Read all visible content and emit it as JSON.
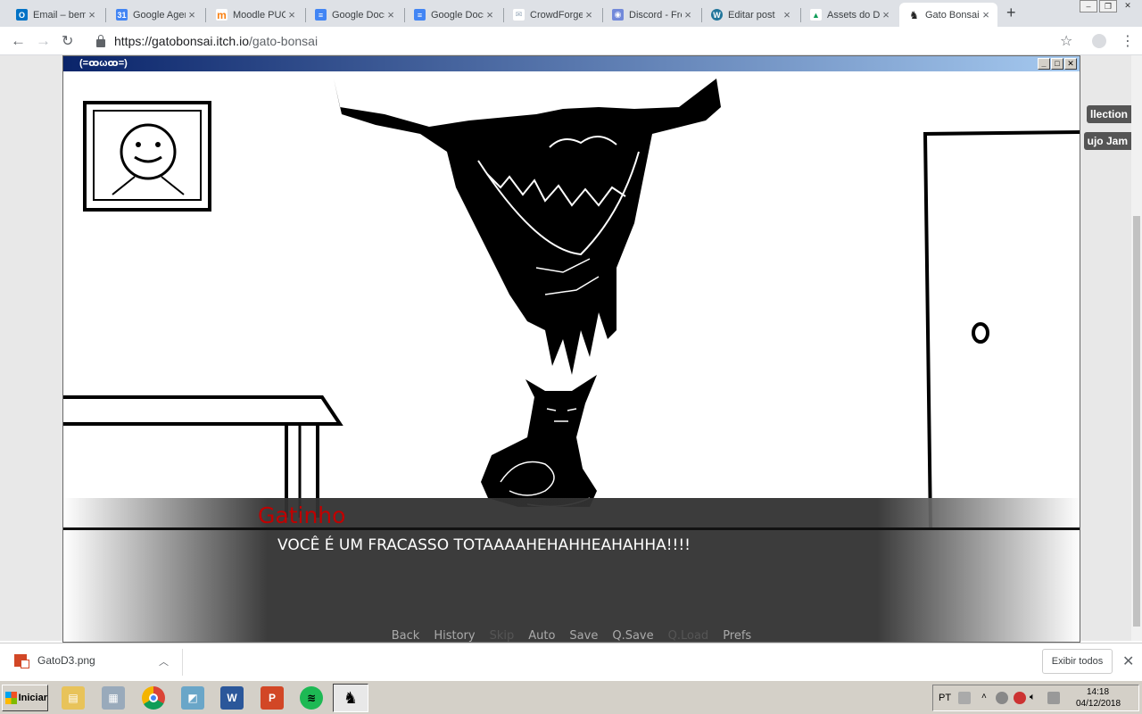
{
  "browser": {
    "tabs": [
      {
        "label": "Email – bem",
        "fav": "O",
        "color": "#0072c6"
      },
      {
        "label": "Google Agen",
        "fav": "31",
        "color": "#4285f4"
      },
      {
        "label": "Moodle PUC",
        "fav": "m",
        "color": "#f98012"
      },
      {
        "label": "Google Docs",
        "fav": "≡",
        "color": "#4285f4"
      },
      {
        "label": "Google Docs",
        "fav": "≡",
        "color": "#4285f4"
      },
      {
        "label": "CrowdForge",
        "fav": "✉",
        "color": "#9ab"
      },
      {
        "label": "Discord - Fre",
        "fav": "◉",
        "color": "#7289da"
      },
      {
        "label": "Editar post",
        "fav": "W",
        "color": "#21759b"
      },
      {
        "label": "Assets do DJ",
        "fav": "▲",
        "color": "#0f9d58"
      },
      {
        "label": "Gato Bonsai",
        "fav": "♞",
        "color": "#222"
      }
    ],
    "new_tab": "+",
    "url_host": "https://gatobonsai.itch.io",
    "url_path": "/gato-bonsai"
  },
  "page": {
    "pill_a": "llection",
    "pill_b": "ujo Jam"
  },
  "game": {
    "window_title": "(=ꝏωꝏ=)",
    "speaker": "Gatinho",
    "dialogue": "VOCÊ É UM FRACASSO TOTAAAAHEHAHHEAHAHHA!!!!",
    "quick_menu": [
      {
        "label": "Back",
        "enabled": true
      },
      {
        "label": "History",
        "enabled": true
      },
      {
        "label": "Skip",
        "enabled": false
      },
      {
        "label": "Auto",
        "enabled": true
      },
      {
        "label": "Save",
        "enabled": true
      },
      {
        "label": "Q.Save",
        "enabled": true
      },
      {
        "label": "Q.Load",
        "enabled": false
      },
      {
        "label": "Prefs",
        "enabled": true
      }
    ]
  },
  "downloads": {
    "file": "GatoD3.png",
    "show_all": "Exibir todos"
  },
  "taskbar": {
    "start": "Iniciar",
    "language": "PT",
    "time": "14:18",
    "date": "04/12/2018"
  }
}
